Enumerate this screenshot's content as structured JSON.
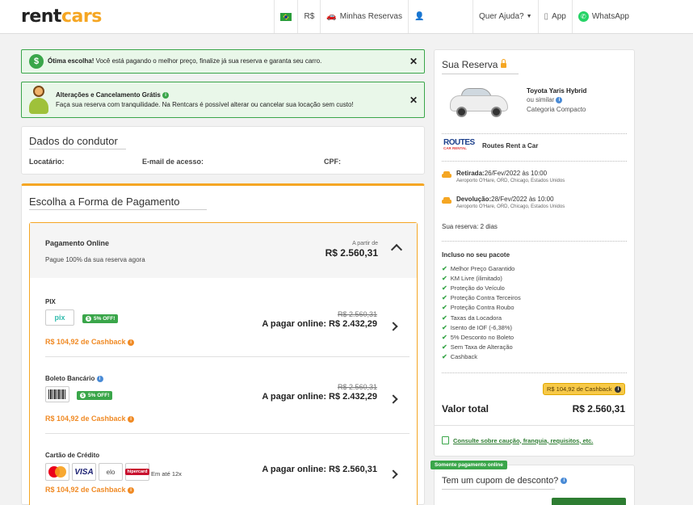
{
  "header": {
    "logo_rent": "rent",
    "logo_cars": "cars",
    "currency": "R$",
    "reservations": "Minhas Reservas",
    "help": "Quer Ajuda?",
    "app": "App",
    "whatsapp": "WhatsApp"
  },
  "alerts": {
    "best_choice_bold": "Ótima escolha!",
    "best_choice_text": " Você está pagando o melhor preço, finalize já sua reserva e garanta seu carro.",
    "changes_title": "Alterações e Cancelamento Grátis",
    "changes_text": "Faça sua reserva com tranquilidade. Na Rentcars é possível alterar ou cancelar sua locação sem custo!"
  },
  "driver": {
    "title": "Dados do condutor",
    "renter_label": "Locatário:",
    "email_label": "E-mail de acesso:",
    "cpf_label": "CPF:"
  },
  "payment": {
    "title": "Escolha a Forma de Pagamento",
    "online_title": "Pagamento Online",
    "online_sub": "Pague 100% da sua reserva agora",
    "from_label": "A partir de",
    "from_price": "R$ 2.560,31",
    "options": [
      {
        "name": "PIX",
        "logo": "pix",
        "badge": "5% OFF!",
        "old_price": "R$ 2.560,31",
        "pay_label": "A pagar online: R$ 2.432,29",
        "cashback": "R$ 104,92 de Cashback"
      },
      {
        "name": "Boleto Bancário",
        "badge": "5% OFF!",
        "old_price": "R$ 2.560,31",
        "pay_label": "A pagar online: R$ 2.432,29",
        "cashback": "R$ 104,92 de Cashback"
      },
      {
        "name": "Cartão de Crédito",
        "installments": "Em até 12x",
        "pay_label": "A pagar online: R$ 2.560,31",
        "cashback": "R$ 104,92 de Cashback"
      }
    ],
    "card_brands": {
      "visa": "VISA",
      "elo": "elo",
      "hiper": "hipercard"
    }
  },
  "reservation": {
    "title": "Sua Reserva",
    "car_name": "Toyota Yaris Hybrid",
    "car_similar": "ou similar",
    "car_category": "Categoria Compacto",
    "rental_logo_1": "ROUTES",
    "rental_logo_2": "CAR RENTAL",
    "rental_name": "Routes Rent a Car",
    "pickup_label": "Retirada:",
    "pickup_date": "26/Fev/2022 às 10:00",
    "pickup_place": "Aeroporto O'Hare, ORD, Chicago, Estados Unidos",
    "return_label": "Devolução:",
    "return_date": "28/Fev/2022 às 10:00",
    "return_place": "Aeroporto O'Hare, ORD, Chicago, Estados Unidos",
    "duration": "Sua reserva:  2 dias",
    "included_title": "Incluso no seu pacote",
    "included": [
      "Melhor Preço Garantido",
      "KM Livre (ilimitado)",
      "Proteção do Veículo",
      "Proteção Contra Terceiros",
      "Proteção Contra Roubo",
      "Taxas da Locadora",
      "Isento de IOF (-6,38%)",
      "5% Desconto no Boleto",
      "Sem Taxa de Alteração",
      "Cashback"
    ],
    "cashback_badge": "R$ 104,92 de Cashback",
    "total_label": "Valor total",
    "total_value": "R$ 2.560,31",
    "consult_link": "Consulte sobre caução, franquia, requisitos, etc."
  },
  "coupon": {
    "tag": "Somente pagamento online",
    "title": "Tem um cupom de desconto?"
  },
  "colors": {
    "brand_orange": "#f5a623",
    "success_green": "#3aa64a",
    "cashback_orange": "#f08a24"
  }
}
